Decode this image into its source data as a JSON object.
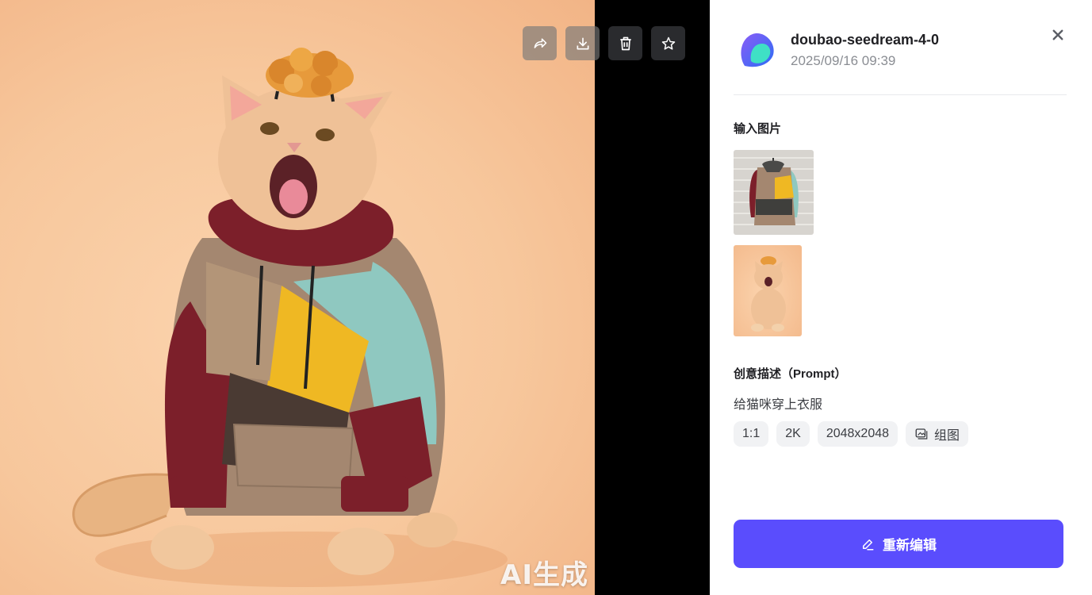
{
  "viewer": {
    "watermark": "AI生成",
    "toolbar": [
      {
        "icon": "share-icon",
        "name": "share-button"
      },
      {
        "icon": "download-icon",
        "name": "download-button"
      },
      {
        "icon": "trash-icon",
        "name": "delete-button"
      },
      {
        "icon": "star-icon",
        "name": "favorite-button"
      }
    ],
    "main_image": "cat-in-colorblock-hoodie"
  },
  "panel": {
    "model_name": "doubao-seedream-4-0",
    "date": "2025/09/16 09:39",
    "input_images_title": "输入图片",
    "input_images": [
      "hoodie-on-hanger",
      "cat-with-fried-topping"
    ],
    "prompt_title": "创意描述（Prompt）",
    "prompt_text": "给猫咪穿上衣服",
    "tags": {
      "ratio": "1:1",
      "quality": "2K",
      "size": "2048x2048",
      "group": "组图"
    },
    "reedit_label": "重新编辑"
  },
  "colors": {
    "accent": "#5a4dfd",
    "tag_bg": "#f1f2f4",
    "viewer_bg": "#000000"
  }
}
